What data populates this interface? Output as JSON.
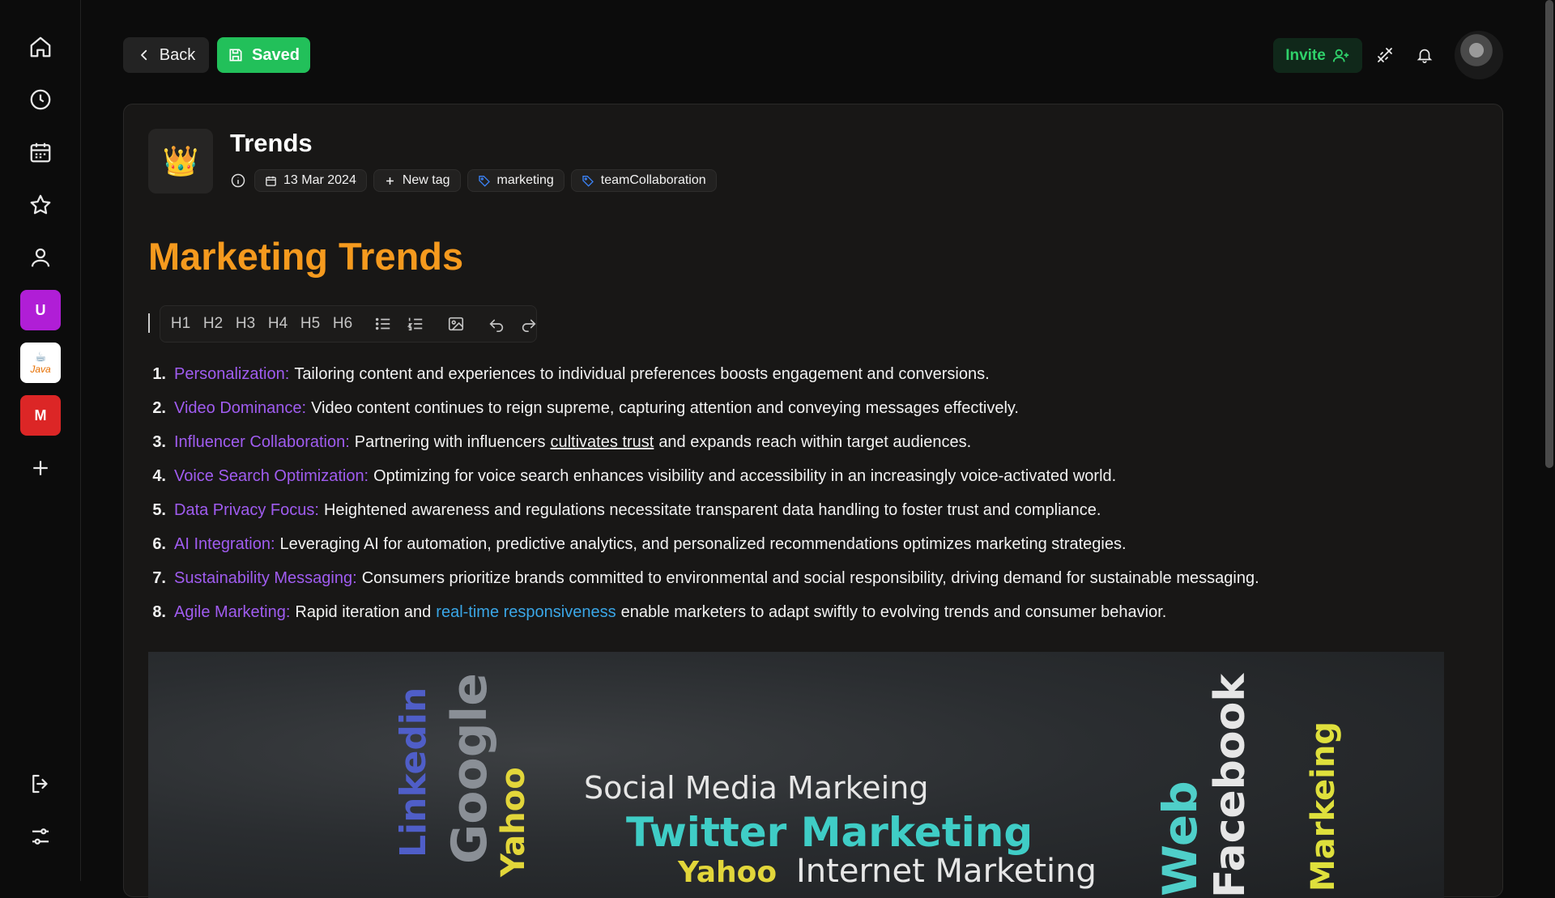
{
  "sidebar": {
    "items": [
      {
        "name": "home-icon"
      },
      {
        "name": "clock-icon"
      },
      {
        "name": "calendar-icon"
      },
      {
        "name": "star-icon"
      },
      {
        "name": "user-icon"
      }
    ],
    "workspaces": [
      {
        "letter": "U",
        "color": "#b01ed6"
      },
      {
        "letter": "Java",
        "color": "#ffffff"
      },
      {
        "letter": "M",
        "color": "#dc2626"
      }
    ]
  },
  "header": {
    "back_label": "Back",
    "saved_label": "Saved",
    "invite_label": "Invite"
  },
  "doc": {
    "emoji": "👑",
    "title": "Trends",
    "date": "13 Mar 2024",
    "new_tag": "New tag",
    "tags": [
      "marketing",
      "teamCollaboration"
    ],
    "heading": "Marketing Trends"
  },
  "toolbar": {
    "headings": [
      "H1",
      "H2",
      "H3",
      "H4",
      "H5",
      "H6"
    ]
  },
  "list": [
    {
      "n": "1.",
      "term": "Personalization:",
      "text": "Tailoring content and experiences to individual preferences boosts engagement and conversions."
    },
    {
      "n": "2.",
      "term": "Video Dominance:",
      "text": "Video content continues to reign supreme, capturing attention and conveying messages effectively."
    },
    {
      "n": "3.",
      "term": "Influencer Collaboration:",
      "pre": "Partnering with influencers",
      "underline": "cultivates trust",
      "post": "and expands reach within target audiences."
    },
    {
      "n": "4.",
      "term": "Voice Search Optimization:",
      "text": "Optimizing for voice search enhances visibility and accessibility in an increasingly voice-activated world."
    },
    {
      "n": "5.",
      "term": "Data Privacy Focus:",
      "text": "Heightened awareness and regulations necessitate transparent data handling to foster trust and compliance."
    },
    {
      "n": "6.",
      "term": "AI Integration:",
      "text": "Leveraging AI for automation, predictive analytics, and personalized recommendations optimizes marketing strategies."
    },
    {
      "n": "7.",
      "term": "Sustainability Messaging:",
      "text": "Consumers prioritize brands committed to environmental and social responsibility, driving demand for sustainable messaging."
    },
    {
      "n": "8.",
      "term": "Agile Marketing:",
      "pre": "Rapid iteration and",
      "link": "real-time responsiveness",
      "post": "enable marketers to adapt swiftly to evolving trends and consumer behavior."
    }
  ],
  "image_words": {
    "linkedin": "Linkedin",
    "google": "Google",
    "yahoo1": "Yahoo",
    "social": "Social Media Markeing",
    "twitter": "Twitter Marketing",
    "yahoo2": "Yahoo",
    "internet": "Internet Marketing",
    "web": "Web",
    "facebook": "Facebook",
    "markeing": "Markeing"
  },
  "colors": {
    "accent_orange": "#f59a1e",
    "term_purple": "#a05cf0",
    "link_blue": "#3aa6e6",
    "saved_green": "#22c05a"
  }
}
